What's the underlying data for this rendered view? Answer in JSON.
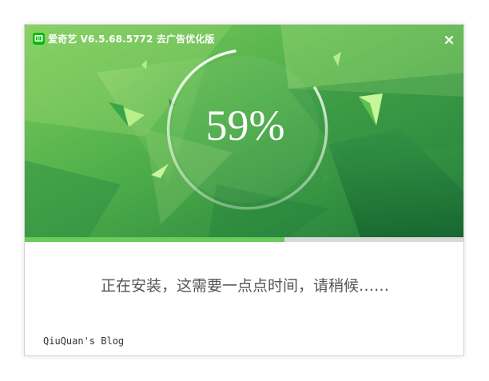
{
  "window": {
    "title": "爱奇艺 V6.5.68.5772 去广告优化版",
    "close_glyph": "×"
  },
  "icons": {
    "app": "iqiyi-logo-icon",
    "close": "close-icon"
  },
  "install": {
    "percent_text": "59%",
    "progress": 0.59,
    "status": "正在安装，这需要一点点时间，请稍候……",
    "footer": "QiuQuan's Blog"
  },
  "colors": {
    "accent": "#6bcb5b",
    "banner_dark": "#1f7a3a",
    "banner_light": "#8fd46e",
    "track": "#d9d9d9",
    "status_text": "#555555"
  }
}
